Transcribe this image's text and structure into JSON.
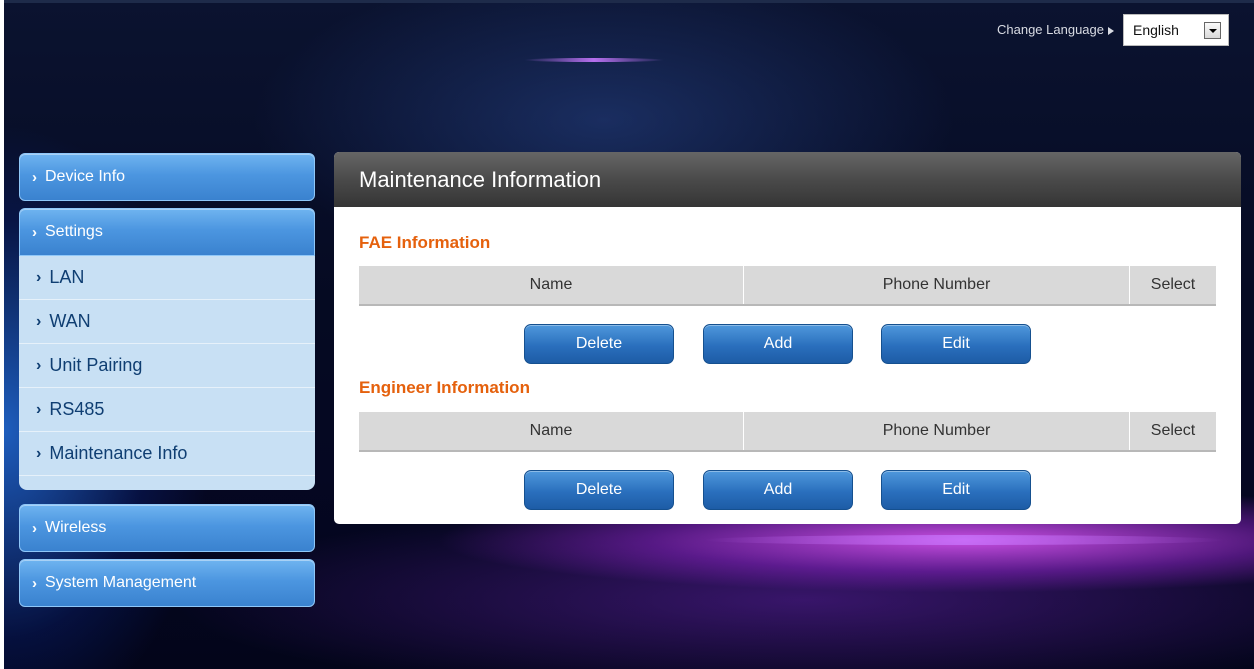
{
  "header": {
    "change_language_label": "Change Language",
    "language_selected": "English"
  },
  "sidebar": {
    "device_info": "Device Info",
    "settings": "Settings",
    "settings_items": [
      "LAN",
      "WAN",
      "Unit Pairing",
      "RS485",
      "Maintenance Info"
    ],
    "wireless": "Wireless",
    "system_management": "System Management"
  },
  "main": {
    "title": "Maintenance Information",
    "fae": {
      "title": "FAE Information",
      "columns": [
        "Name",
        "Phone Number",
        "Select"
      ],
      "buttons": {
        "delete": "Delete",
        "add": "Add",
        "edit": "Edit"
      }
    },
    "engineer": {
      "title": "Engineer Information",
      "columns": [
        "Name",
        "Phone Number",
        "Select"
      ],
      "buttons": {
        "delete": "Delete",
        "add": "Add",
        "edit": "Edit"
      }
    }
  },
  "colors": {
    "menu_blue": "#4c96e0",
    "submenu_bg": "#c8e0f4",
    "section_title": "#e5610d",
    "button_blue": "#2a6fbd"
  },
  "icons": {
    "menu_chevron": "chevron-right-icon",
    "language_arrow": "triangle-right-icon",
    "dropdown": "chevron-down-icon"
  }
}
